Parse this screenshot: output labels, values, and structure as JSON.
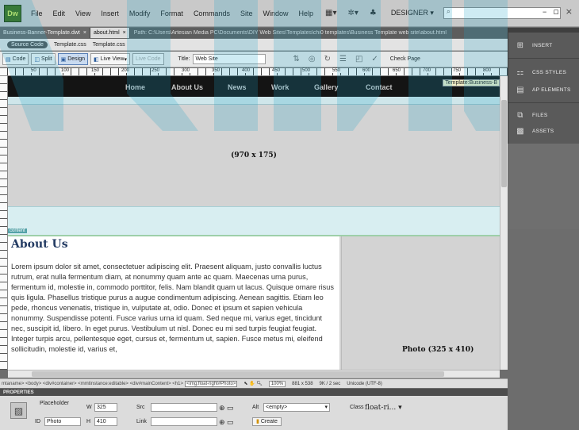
{
  "app": {
    "logo": "Dw",
    "menu": [
      "File",
      "Edit",
      "View",
      "Insert",
      "Modify",
      "Format",
      "Commands",
      "Site",
      "Window",
      "Help"
    ],
    "workspace": "DESIGNER",
    "search_placeholder": "",
    "window_controls": [
      "–",
      "▫",
      "×"
    ]
  },
  "tabs": [
    {
      "label": "Business-Banner-Template.dwt",
      "active": false
    },
    {
      "label": "about.html",
      "active": true
    }
  ],
  "file_path": "Path: C:\\Users\\Artesian Media PC\\Documents\\DIY Web Sites\\Templates\\chi0 templates\\Business Template web site\\about.html",
  "related_files": {
    "source_label": "Source Code",
    "files": [
      "Template.css",
      "Template.css"
    ]
  },
  "doc_toolbar": {
    "code": "Code",
    "split": "Split",
    "design": "Design",
    "live_view": "Live View",
    "live_code": "Live Code",
    "title_label": "Title:",
    "title_value": "Web Site",
    "check_page": "Check Page"
  },
  "ruler": {
    "marks": [
      "50",
      "100",
      "150",
      "200",
      "250",
      "300",
      "350",
      "400",
      "450",
      "500",
      "550",
      "600",
      "650",
      "700",
      "750",
      "800"
    ]
  },
  "page": {
    "nav": [
      "Home",
      "About Us",
      "News",
      "Work",
      "Gallery",
      "Contact"
    ],
    "template_badge": "Template:Business-B",
    "banner_label": "(970 x 175)",
    "content_tag": "content",
    "about_title": "About Us",
    "body_text": "Lorem ipsum dolor sit amet, consectetuer adipiscing elit. Praesent aliquam, justo convallis luctus rutrum, erat nulla fermentum diam, at nonummy quam ante ac quam. Maecenas urna purus, fermentum id, molestie in, commodo porttitor, felis. Nam blandit quam ut lacus. Quisque ornare risus quis ligula. Phasellus tristique purus a augue condimentum adipiscing. Aenean sagittis. Etiam leo pede, rhoncus venenatis, tristique in, vulputate at, odio. Donec et ipsum et sapien vehicula nonummy. Suspendisse potenti. Fusce varius urna id quam. Sed neque mi, varius eget, tincidunt nec, suscipit id, libero. In eget purus. Vestibulum ut nisl. Donec eu mi sed turpis feugiat feugiat. Integer turpis arcu, pellentesque eget, cursus et, fermentum ut, sapien. Fusce metus mi, eleifend sollicitudin, molestie id, varius et,",
    "photo_label": "Photo (325 x 410)"
  },
  "status": {
    "tag_path": "mtaname> <body> <div#container> <mmtinstance:editable> <div#mainContent> <h1>",
    "selected_tag": "<img.float-right#Photo>",
    "zoom": "100%",
    "dimensions": "881 x 538",
    "size": "9K / 2 sec",
    "encoding": "Unicode (UTF-8)"
  },
  "properties": {
    "header": "PROPERTIES",
    "type": "Placeholder",
    "id_label": "ID",
    "id_value": "Photo",
    "w_label": "W",
    "w_value": "325",
    "h_label": "H",
    "h_value": "410",
    "src_label": "Src",
    "link_label": "Link",
    "alt_label": "Alt",
    "alt_value": "<empty>",
    "create_label": "Create",
    "class_label": "Class",
    "class_value": "float-ri..."
  },
  "panels": [
    {
      "label": "INSERT",
      "icon": "insert-icon"
    },
    {
      "label": "CSS STYLES",
      "icon": "css-styles-icon"
    },
    {
      "label": "AP ELEMENTS",
      "icon": "ap-elements-icon"
    },
    {
      "label": "FILES",
      "icon": "files-icon"
    },
    {
      "label": "ASSETS",
      "icon": "assets-icon"
    }
  ],
  "colors": {
    "nav_bg": "#141414",
    "watermark": "#1fa5c9"
  }
}
